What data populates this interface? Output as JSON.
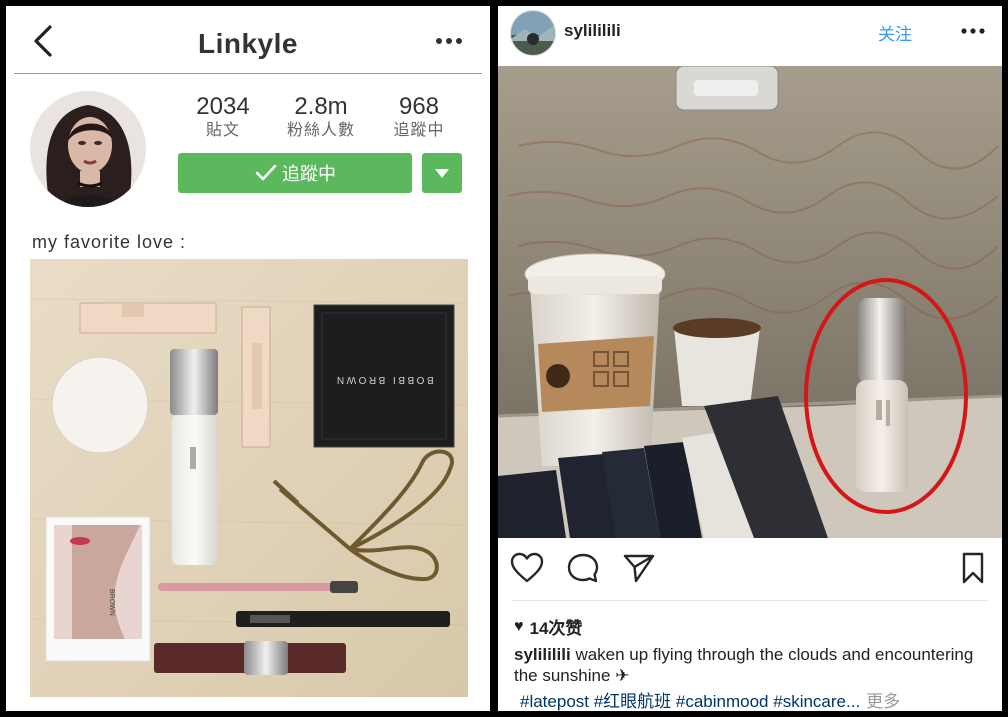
{
  "left": {
    "title": "Linkyle",
    "stats": [
      {
        "value": "2034",
        "label": "貼文"
      },
      {
        "value": "2.8m",
        "label": "粉絲人數"
      },
      {
        "value": "968",
        "label": "追蹤中"
      }
    ],
    "follow_label": "追蹤中",
    "bio": "my favorite love :",
    "palette_brand": "BOBBI BROWN",
    "postcard_text": "BROWN"
  },
  "right": {
    "username": "sylililili",
    "follow_label": "关注",
    "likes": "14次赞",
    "caption_user": "sylililili",
    "caption_text": "waken up flying through the clouds and encountering the sunshine ✈",
    "tags": "#latepost #红眼航班 #cabinmood #skincare...",
    "more_label": "更多"
  },
  "colors": {
    "follow_green": "#5cb85c",
    "link_blue": "#3897f0",
    "hashtag_blue": "#003569",
    "circle_red": "#d41616"
  },
  "icons": [
    "back-arrow-icon",
    "more-dots-icon",
    "check-icon",
    "caret-down-icon",
    "heart-icon",
    "comment-icon",
    "share-icon",
    "bookmark-icon"
  ]
}
